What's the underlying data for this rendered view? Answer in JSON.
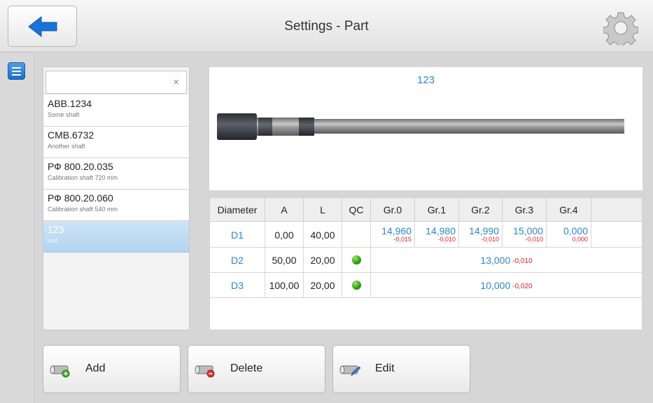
{
  "header": {
    "title": "Settings - Part"
  },
  "search": {
    "value": "",
    "clear_symbol": "×"
  },
  "parts": [
    {
      "name": "ABB.1234",
      "desc": "Some shaft",
      "selected": false
    },
    {
      "name": "CMB.6732",
      "desc": "Another shaft",
      "selected": false
    },
    {
      "name": "РФ 800.20.035",
      "desc": "Calibration shaft 720 mm",
      "selected": false
    },
    {
      "name": "РФ 800.20.060",
      "desc": "Calibration shaft 540 mm",
      "selected": false
    },
    {
      "name": "123",
      "desc": "test",
      "selected": true
    }
  ],
  "preview": {
    "label": "123"
  },
  "table": {
    "headers": [
      "Diameter",
      "A",
      "L",
      "QC",
      "Gr.0",
      "Gr.1",
      "Gr.2",
      "Gr.3",
      "Gr.4"
    ],
    "rows": [
      {
        "diameter": "D1",
        "a": "0,00",
        "l": "40,00",
        "qc": "",
        "grades": [
          {
            "value": "14,960",
            "tol": "-0,015"
          },
          {
            "value": "14,980",
            "tol": "-0,010"
          },
          {
            "value": "14,990",
            "tol": "-0,010"
          },
          {
            "value": "15,000",
            "tol": "-0,010"
          },
          {
            "value": "0,000",
            "tol": "0,000"
          }
        ]
      },
      {
        "diameter": "D2",
        "a": "50,00",
        "l": "20,00",
        "qc": "ok",
        "merged": {
          "value": "13,000",
          "tol": "-0,010"
        }
      },
      {
        "diameter": "D3",
        "a": "100,00",
        "l": "20,00",
        "qc": "ok",
        "merged": {
          "value": "10,000",
          "tol": "-0,020"
        }
      }
    ]
  },
  "buttons": {
    "add": "Add",
    "delete": "Delete",
    "edit": "Edit"
  },
  "icons": {
    "back": "back-arrow-icon",
    "settings": "gear-icon",
    "menu": "menu-icon"
  },
  "colors": {
    "accent": "#2b86d2",
    "tolerance": "#e02020",
    "qc_ok": "#2f9a10",
    "selection": "#b3d4f0"
  }
}
